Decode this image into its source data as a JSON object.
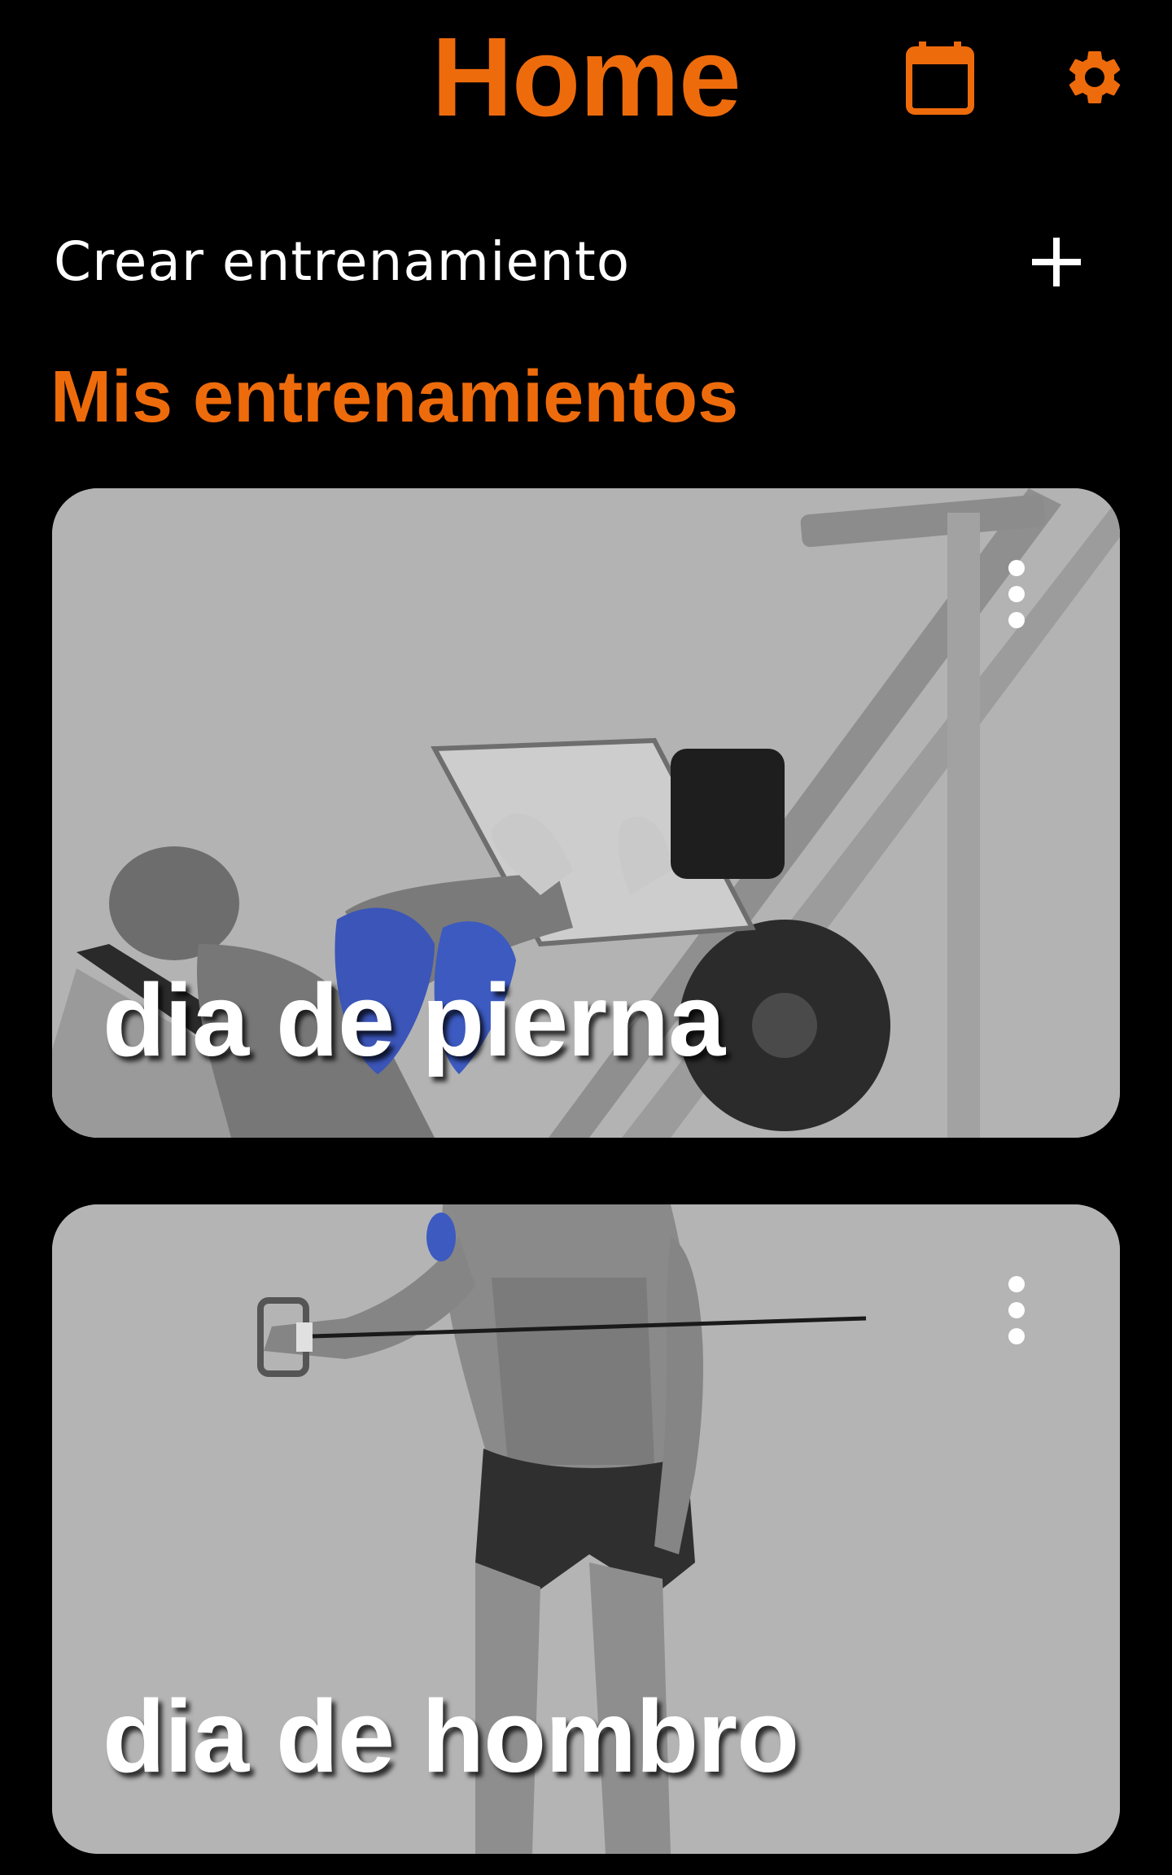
{
  "header": {
    "title": "Home",
    "calendar_icon": "calendar-icon",
    "settings_icon": "gear-icon"
  },
  "create": {
    "label": "Crear entrenamiento",
    "icon": "plus-icon"
  },
  "section": {
    "title": "Mis entrenamientos"
  },
  "workouts": [
    {
      "title": "dia de pierna",
      "image": "leg-press-illustration",
      "menu_icon": "more-vertical-icon"
    },
    {
      "title": "dia de hombro",
      "image": "cable-lateral-raise-illustration",
      "menu_icon": "more-vertical-icon"
    }
  ],
  "colors": {
    "accent": "#ee6b0c",
    "background": "#000000",
    "card_background": "#b4b4b4",
    "text": "#ffffff"
  }
}
